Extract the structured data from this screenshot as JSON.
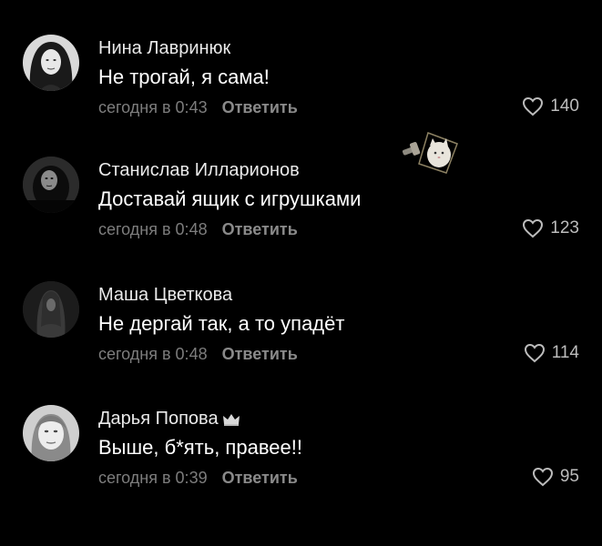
{
  "comments": [
    {
      "author": "Нина Лавринюк",
      "text": "Не трогай, я сама!",
      "time": "сегодня в 0:43",
      "reply_label": "Ответить",
      "likes": "140",
      "avatar_icon": "woman-portrait-avatar"
    },
    {
      "author": "Станислав Илларионов",
      "text": "Доставай ящик с игрушками",
      "time": "сегодня в 0:48",
      "reply_label": "Ответить",
      "likes": "123",
      "avatar_icon": "dark-portrait-avatar"
    },
    {
      "author": "Маша Цветкова",
      "text": "Не дергай так, а то упадёт",
      "time": "сегодня в 0:48",
      "reply_label": "Ответить",
      "likes": "114",
      "avatar_icon": "long-hair-silhouette-avatar"
    },
    {
      "author": "Дарья Попова",
      "text": "Выше, б*ять, правее!!",
      "time": "сегодня в 0:39",
      "reply_label": "Ответить",
      "likes": "95",
      "avatar_icon": "woman-face-avatar",
      "badge_icon": "crown-icon"
    }
  ],
  "colors": {
    "background": "#000000",
    "author": "#eaeaea",
    "text": "#ffffff",
    "meta": "#7d7d7d",
    "likes": "#bcbcbc"
  },
  "sticker_icon": "cat-sticker"
}
